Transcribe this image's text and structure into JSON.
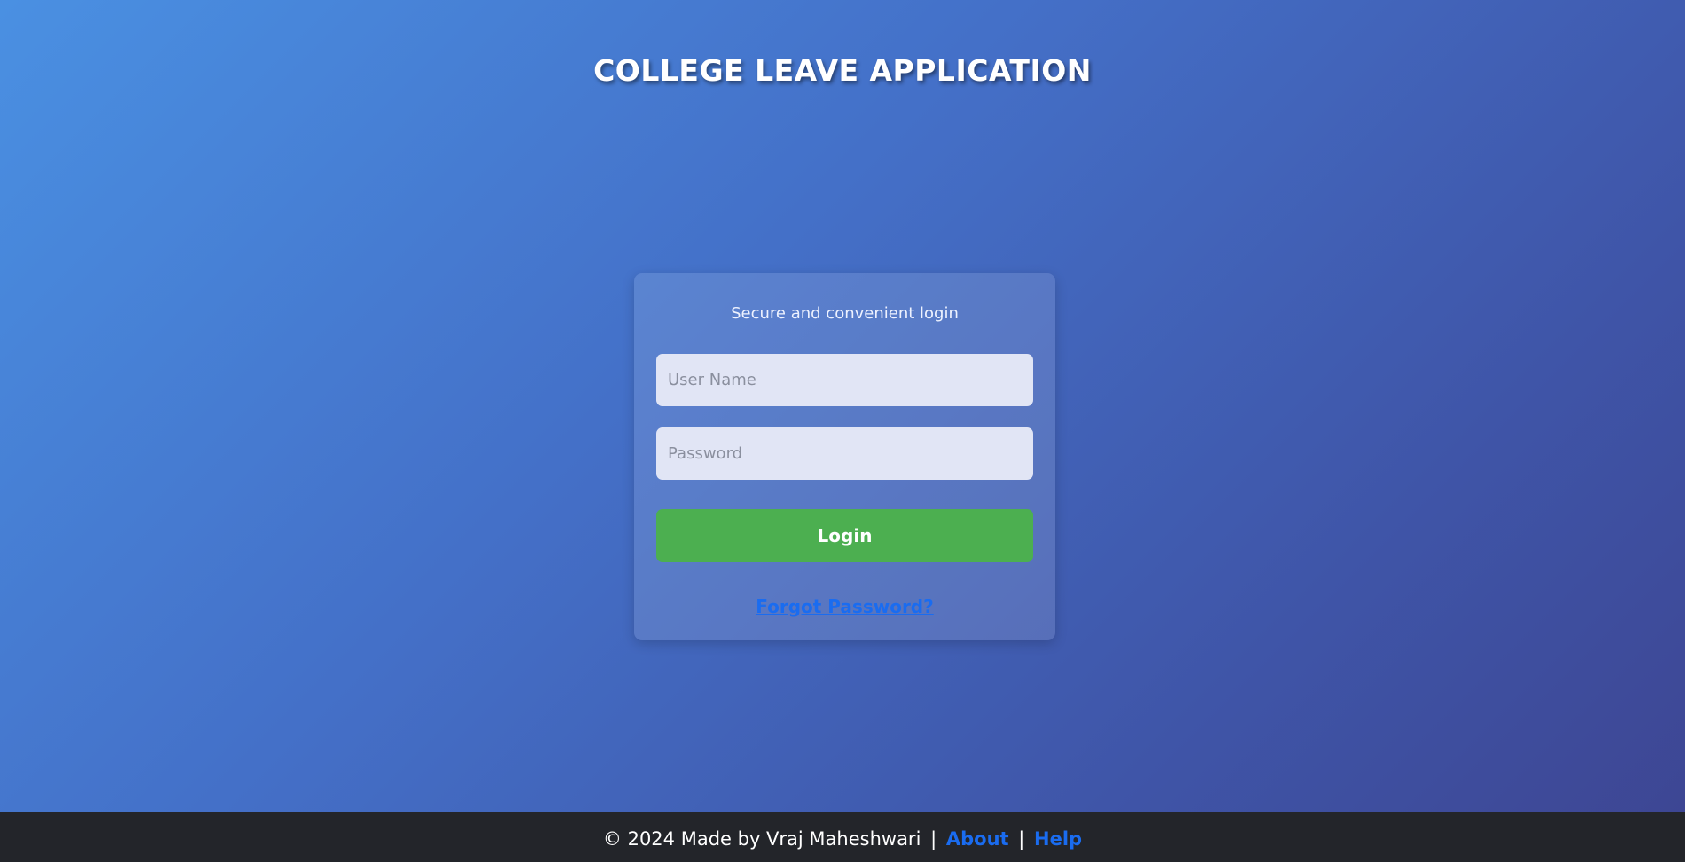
{
  "header": {
    "title": "COLLEGE LEAVE APPLICATION"
  },
  "login_card": {
    "subtitle": "Secure and convenient login",
    "username_placeholder": "User Name",
    "username_value": "",
    "password_placeholder": "Password",
    "password_value": "",
    "login_label": "Login",
    "forgot_label": "Forgot Password?"
  },
  "footer": {
    "copyright": "© 2024 Made by Vraj Maheshwari",
    "separator": "|",
    "about_label": "About",
    "help_label": "Help"
  },
  "colors": {
    "gradient_start": "#4a90e2",
    "gradient_end": "#3d4592",
    "login_button": "#4caf50",
    "link": "#1a6cf0",
    "footer_bg": "#23252a"
  }
}
